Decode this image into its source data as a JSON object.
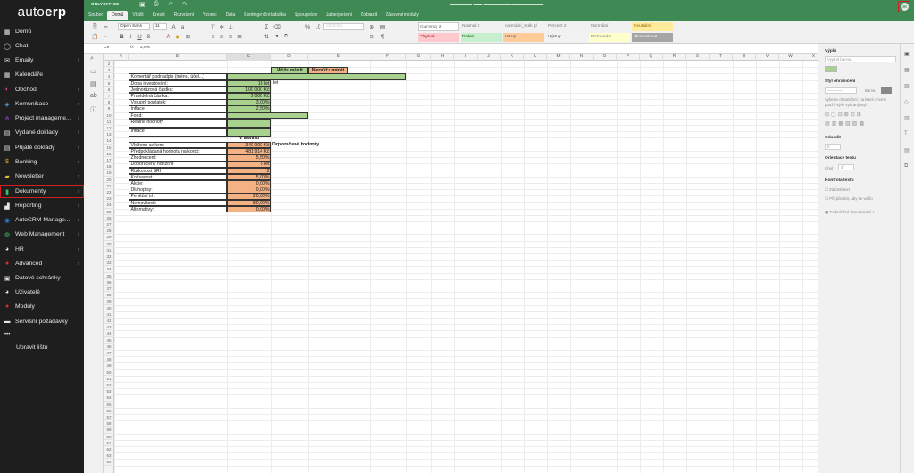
{
  "sidebar": {
    "logo_prefix": "auto",
    "logo_suffix": "erp",
    "items": [
      {
        "label": "Domů",
        "icon": "grid-icon"
      },
      {
        "label": "Chat",
        "icon": "chat-icon"
      },
      {
        "label": "Emaily",
        "icon": "envelope-icon"
      },
      {
        "label": "Kalendáře",
        "icon": "calendar-icon"
      },
      {
        "label": "Obchod",
        "icon": "shop-icon"
      },
      {
        "label": "Komunikace",
        "icon": "megaphone-icon"
      },
      {
        "label": "Project manageme...",
        "icon": "project-icon"
      },
      {
        "label": "Vydané doklady",
        "icon": "document-out-icon"
      },
      {
        "label": "Přijaté doklady",
        "icon": "document-in-icon"
      },
      {
        "label": "Banking",
        "icon": "dollar-icon"
      },
      {
        "label": "Newsletter",
        "icon": "newsletter-icon"
      },
      {
        "label": "Dokumenty",
        "icon": "folder-icon"
      },
      {
        "label": "Reporting",
        "icon": "chart-icon"
      },
      {
        "label": "AutoCRM Manage...",
        "icon": "crm-icon"
      },
      {
        "label": "Web Management",
        "icon": "globe-icon"
      },
      {
        "label": "HR",
        "icon": "people-icon"
      },
      {
        "label": "Advanced",
        "icon": "advanced-icon"
      },
      {
        "label": "Datové schránky",
        "icon": "mailbox-icon"
      },
      {
        "label": "Uživatelé",
        "icon": "user-icon"
      },
      {
        "label": "Moduly",
        "icon": "modules-icon"
      },
      {
        "label": "Servisní požadavky",
        "icon": "service-icon"
      }
    ],
    "more": "•••",
    "edit_label": "Upravit lištu"
  },
  "header": {
    "brand": "ONLYOFFICE",
    "user_initials": "OK",
    "tabs": [
      "Soubor",
      "Domů",
      "Vložit",
      "Kreslit",
      "Rozvržení",
      "Vzorec",
      "Data",
      "Kontingenční tabulka",
      "Spolupráce",
      "Zabezpečení",
      "Zobrazit",
      "Zásuvné moduly"
    ],
    "active_tab": "Domů"
  },
  "toolbar": {
    "font_name": "Open Sans",
    "font_size": "11",
    "styles_row1": [
      "Currency 2",
      "Normal 2",
      "normální_Kalk pl",
      "Percent 2",
      "Normální",
      "Neutrální"
    ],
    "styles_row2": [
      "Chybné",
      "Dobré",
      "Vstup",
      "Výstup",
      "Poznámka",
      "Zkontrolovat"
    ]
  },
  "formula_bar": {
    "cell_ref": "C9",
    "fx": "fx",
    "content": "2,5%"
  },
  "sheet": {
    "columns": [
      "A",
      "B",
      "C",
      "D",
      "E",
      "F",
      "G",
      "H",
      "I",
      "J",
      "K",
      "L",
      "M",
      "N",
      "O",
      "P",
      "Q",
      "R",
      "S",
      "T",
      "U",
      "V",
      "W",
      "X"
    ],
    "selected_column": "C",
    "header_can_change": "Můžu měnit",
    "header_cannot_change": "Nemůžu měnit",
    "comment_label": "Komentář podnadpis (méno, účel...)",
    "inputs": [
      {
        "label": "Doba investování:",
        "value": "10 let",
        "unit": "let"
      },
      {
        "label": "Jednorázová částka:",
        "value": "100 000 Kč"
      },
      {
        "label": "Pravidelná částka:",
        "value": "2 000 Kč"
      },
      {
        "label": "Vstupní poplatek:",
        "value": "3,00%"
      },
      {
        "label": "Inflace:",
        "value": "2,50%"
      }
    ],
    "fond_label": "Fond:",
    "real_label": "Reálné hodnoty",
    "inflace_label": "Inflace",
    "section_title": "V návrhu",
    "recommended_label": "Doporučené hodnoty",
    "outputs": [
      {
        "label": "Vloženo celkem:",
        "value": "340 000 Kč"
      },
      {
        "label": "Předpokládaná hodnota na konci:",
        "value": "481 914 Kč"
      },
      {
        "label": "Zhodnocení:",
        "value": "5,50%"
      },
      {
        "label": "Doporučený horizont",
        "value": "5 let"
      },
      {
        "label": "Rizikovost SRI",
        "value": "2"
      },
      {
        "label": "Kolísavost",
        "value": "5,00%"
      },
      {
        "label": "Akcie:",
        "value": "0,00%"
      },
      {
        "label": "Dluhopisy:",
        "value": "0,00%"
      },
      {
        "label": "Peněžní trh:",
        "value": "20,00%"
      },
      {
        "label": "Nemovitosti:",
        "value": "80,00%"
      },
      {
        "label": "Alternativy:",
        "value": "0,00%"
      }
    ]
  },
  "right_panel": {
    "fill_title": "Výplň",
    "fill_value": "Vyplnit barvou",
    "border_title": "Styl ohraničení",
    "border_color_label": "Barva",
    "border_hint": "Vyberte ohraničení, na které chcete použít výše vybraný styl",
    "indent_title": "Odsadit",
    "indent_value": "0",
    "orientation_title": "Orientace textu",
    "orientation_value": "Úhel",
    "textcontrol_title": "Kontrola textu",
    "wrap_label": "Zalomit text",
    "shrink_label": "Přizpůsobit, aby se vešlo",
    "conditional_label": "Podmíněné formátování"
  }
}
